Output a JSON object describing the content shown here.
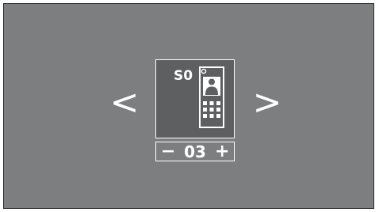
{
  "navigation": {
    "prev_label": "<",
    "next_label": ">"
  },
  "device_card": {
    "label": "S0",
    "icon": "door-station-icon"
  },
  "counter": {
    "decrement_label": "−",
    "value": "03",
    "increment_label": "+"
  },
  "colors": {
    "background": "#7d7e80",
    "card": "#5e5f60",
    "foreground": "#ffffff"
  }
}
